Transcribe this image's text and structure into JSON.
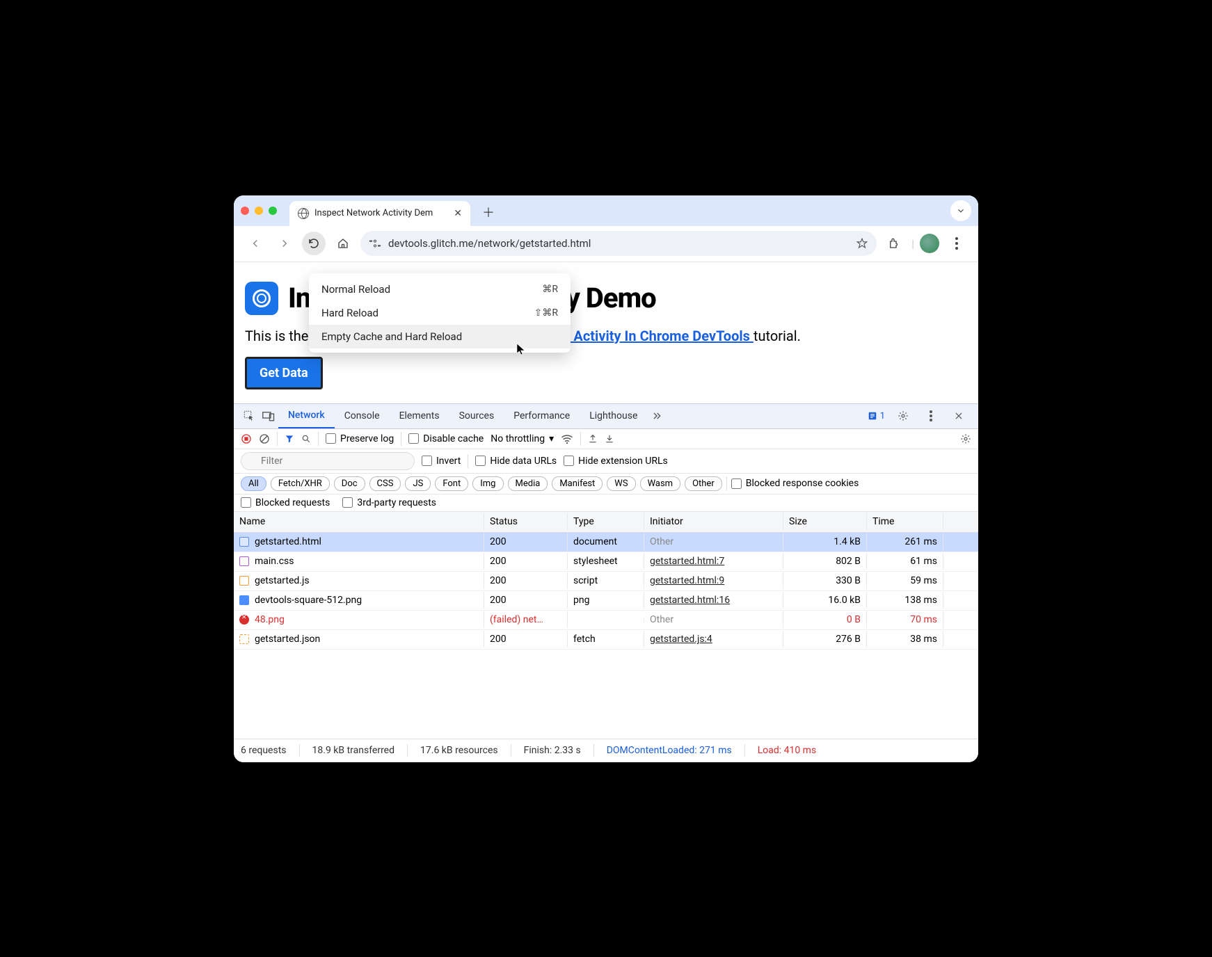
{
  "tab": {
    "title": "Inspect Network Activity Dem"
  },
  "url": "devtools.glitch.me/network/getstarted.html",
  "context_menu": {
    "items": [
      {
        "label": "Normal Reload",
        "shortcut": "⌘R"
      },
      {
        "label": "Hard Reload",
        "shortcut": "⇧⌘R"
      },
      {
        "label": "Empty Cache and Hard Reload",
        "shortcut": ""
      }
    ]
  },
  "page": {
    "heading": "Inspect Network Activity Demo",
    "sub_prefix": "This is the companion demo for the ",
    "sub_link": "Inspect Network Activity In Chrome DevTools ",
    "sub_suffix": "tutorial.",
    "button": "Get Data"
  },
  "devtools": {
    "tabs": [
      "Network",
      "Console",
      "Elements",
      "Sources",
      "Performance",
      "Lighthouse"
    ],
    "issues_count": "1",
    "toolbar": {
      "preserve_log": "Preserve log",
      "disable_cache": "Disable cache",
      "throttling": "No throttling"
    },
    "filter": {
      "placeholder": "Filter",
      "invert": "Invert",
      "hide_data": "Hide data URLs",
      "hide_ext": "Hide extension URLs",
      "types": [
        "All",
        "Fetch/XHR",
        "Doc",
        "CSS",
        "JS",
        "Font",
        "Img",
        "Media",
        "Manifest",
        "WS",
        "Wasm",
        "Other"
      ],
      "blocked_cookies": "Blocked response cookies",
      "blocked_requests": "Blocked requests",
      "third_party": "3rd-party requests"
    },
    "columns": {
      "name": "Name",
      "status": "Status",
      "type": "Type",
      "initiator": "Initiator",
      "size": "Size",
      "time": "Time"
    },
    "rows": [
      {
        "icon": "doc",
        "name": "getstarted.html",
        "status": "200",
        "type": "document",
        "initiator": "Other",
        "initiator_link": false,
        "size": "1.4 kB",
        "time": "261 ms",
        "selected": true,
        "failed": false
      },
      {
        "icon": "css",
        "name": "main.css",
        "status": "200",
        "type": "stylesheet",
        "initiator": "getstarted.html:7",
        "initiator_link": true,
        "size": "802 B",
        "time": "61 ms",
        "selected": false,
        "failed": false
      },
      {
        "icon": "js",
        "name": "getstarted.js",
        "status": "200",
        "type": "script",
        "initiator": "getstarted.html:9",
        "initiator_link": true,
        "size": "330 B",
        "time": "59 ms",
        "selected": false,
        "failed": false
      },
      {
        "icon": "img",
        "name": "devtools-square-512.png",
        "status": "200",
        "type": "png",
        "initiator": "getstarted.html:16",
        "initiator_link": true,
        "size": "16.0 kB",
        "time": "138 ms",
        "selected": false,
        "failed": false
      },
      {
        "icon": "err",
        "name": "48.png",
        "status": "(failed) net…",
        "type": "",
        "initiator": "Other",
        "initiator_link": false,
        "size": "0 B",
        "time": "70 ms",
        "selected": false,
        "failed": true
      },
      {
        "icon": "json",
        "name": "getstarted.json",
        "status": "200",
        "type": "fetch",
        "initiator": "getstarted.js:4",
        "initiator_link": true,
        "size": "276 B",
        "time": "38 ms",
        "selected": false,
        "failed": false
      }
    ],
    "status": {
      "requests": "6 requests",
      "transferred": "18.9 kB transferred",
      "resources": "17.6 kB resources",
      "finish": "Finish: 2.33 s",
      "dcl": "DOMContentLoaded: 271 ms",
      "load": "Load: 410 ms"
    }
  }
}
